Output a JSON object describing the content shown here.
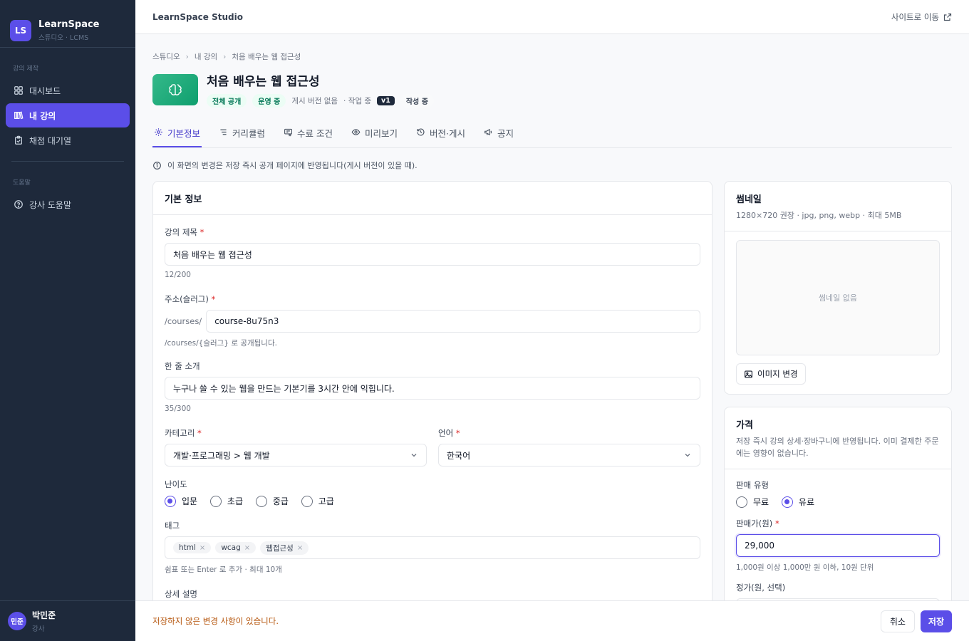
{
  "brand": {
    "logo": "LS",
    "name": "LearnSpace",
    "sub": "스튜디오 · LCMS"
  },
  "sidebar": {
    "section1": "강의 제작",
    "items": [
      {
        "label": "대시보드",
        "icon": "dashboard-icon"
      },
      {
        "label": "내 강의",
        "icon": "book-icon"
      },
      {
        "label": "채점 대기열",
        "icon": "clipboard-icon"
      }
    ],
    "section2": "도움말",
    "help": {
      "label": "강사 도움말",
      "icon": "help-icon"
    }
  },
  "user": {
    "avatar": "민준",
    "name": "박민준",
    "role": "강사"
  },
  "topbar": {
    "title": "LearnSpace Studio",
    "link": "사이트로 이동"
  },
  "breadcrumb": [
    "스튜디오",
    "내 강의",
    "처음 배우는 웹 접근성"
  ],
  "course": {
    "title": "처음 배우는 웹 접근성",
    "badge_public": "전체 공개",
    "badge_status": "운영 중",
    "published": "게시 버전 없음",
    "work_label": "· 작업 중",
    "version": "v1",
    "draft": "작성 중"
  },
  "tabs": [
    "기본정보",
    "커리큘럼",
    "수료 조건",
    "미리보기",
    "버전·게시",
    "공지"
  ],
  "notice": "이 화면의 변경은 저장 즉시 공개 페이지에 반영됩니다(게시 버전이 있을 때).",
  "basic": {
    "title": "기본 정보",
    "course_title_label": "강의 제목",
    "course_title_value": "처음 배우는 웹 접근성",
    "course_title_count": "12/200",
    "slug_label": "주소(슬러그)",
    "slug_prefix": "/courses/",
    "slug_value": "course-8u75n3",
    "slug_hint": "/courses/{슬러그} 로 공개됩니다.",
    "summary_label": "한 줄 소개",
    "summary_value": "누구나 쓸 수 있는 웹을 만드는 기본기를 3시간 안에 익힙니다.",
    "summary_count": "35/300",
    "category_label": "카테고리",
    "category_value": "개발·프로그래밍 > 웹 개발",
    "language_label": "언어",
    "language_value": "한국어",
    "level_label": "난이도",
    "levels": [
      "입문",
      "초급",
      "중급",
      "고급"
    ],
    "level_selected": 0,
    "tags_label": "태그",
    "tags": [
      "html",
      "wcag",
      "웹접근성"
    ],
    "tags_hint": "쉼표 또는 Enter 로 추가 · 최대 10개",
    "desc_label": "상세 설명"
  },
  "thumbnail": {
    "title": "썸네일",
    "sub": "1280×720 권장 · jpg, png, webp · 최대 5MB",
    "empty": "썸네일 없음",
    "change_button": "이미지 변경"
  },
  "price": {
    "title": "가격",
    "sub": "저장 즉시 강의 상세·장바구니에 반영됩니다. 이미 결제한 주문에는 영향이 없습니다.",
    "sale_type_label": "판매 유형",
    "types": [
      "무료",
      "유료"
    ],
    "type_selected": 1,
    "price_label": "판매가(원)",
    "price_value": "29,000",
    "price_hint": "1,000원 이상 1,000만 원 이하, 10원 단위",
    "list_price_label": "정가(원, 선택)"
  },
  "footer": {
    "message": "저장하지 않은 변경 사항이 있습니다.",
    "cancel": "취소",
    "save": "저장"
  },
  "colors": {
    "accent": "#5b4ee8",
    "sidebar": "#1e293b",
    "warning": "#b45309"
  }
}
